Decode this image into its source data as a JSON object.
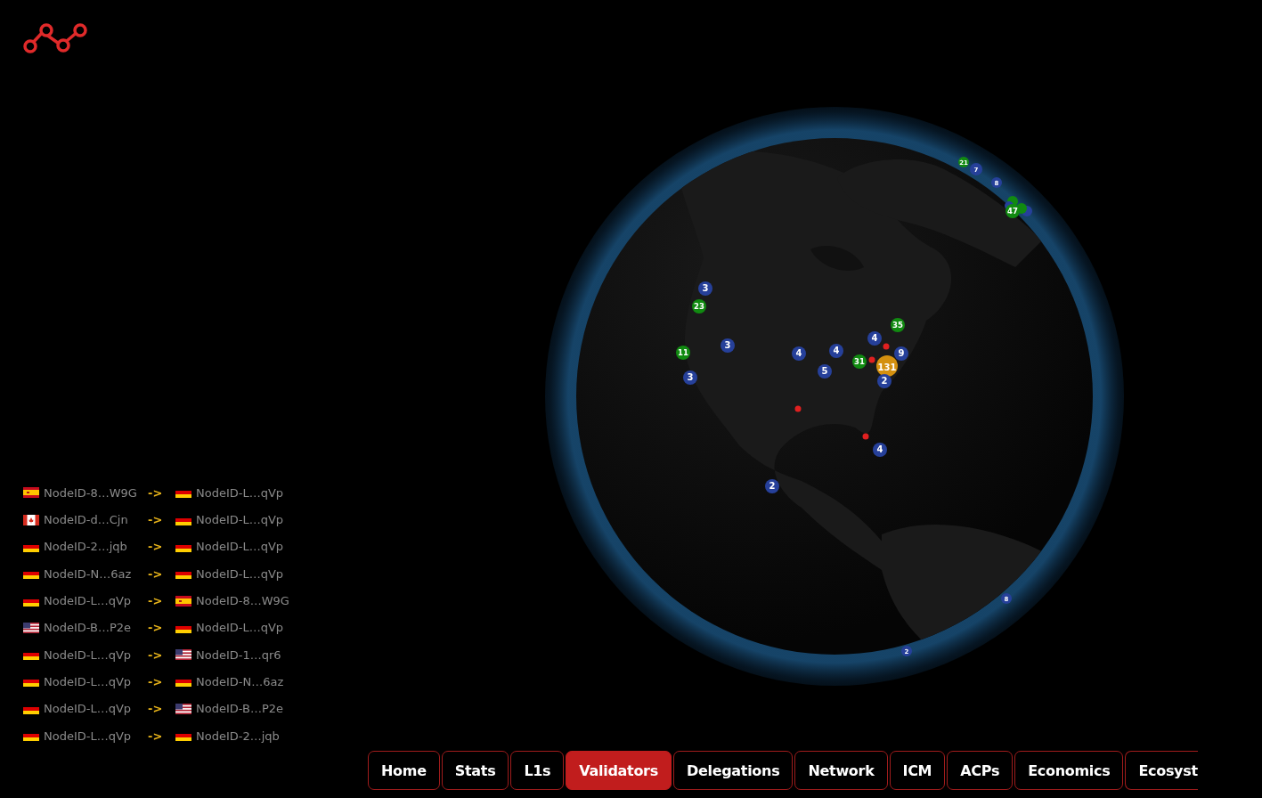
{
  "connections": [
    {
      "from": {
        "kind": "es",
        "node": "NodeID-8…W9G"
      },
      "arrow": "->",
      "to": {
        "kind": "de",
        "node": "NodeID-L…qVp"
      }
    },
    {
      "from": {
        "kind": "ca",
        "node": "NodeID-d…Cjn"
      },
      "arrow": "->",
      "to": {
        "kind": "de",
        "node": "NodeID-L…qVp"
      }
    },
    {
      "from": {
        "kind": "de",
        "node": "NodeID-2…jqb"
      },
      "arrow": "->",
      "to": {
        "kind": "de",
        "node": "NodeID-L…qVp"
      }
    },
    {
      "from": {
        "kind": "de",
        "node": "NodeID-N…6az"
      },
      "arrow": "->",
      "to": {
        "kind": "de",
        "node": "NodeID-L…qVp"
      }
    },
    {
      "from": {
        "kind": "de",
        "node": "NodeID-L…qVp"
      },
      "arrow": "->",
      "to": {
        "kind": "es",
        "node": "NodeID-8…W9G"
      }
    },
    {
      "from": {
        "kind": "us",
        "node": "NodeID-B…P2e"
      },
      "arrow": "->",
      "to": {
        "kind": "de",
        "node": "NodeID-L…qVp"
      }
    },
    {
      "from": {
        "kind": "de",
        "node": "NodeID-L…qVp"
      },
      "arrow": "->",
      "to": {
        "kind": "us",
        "node": "NodeID-1…qr6"
      }
    },
    {
      "from": {
        "kind": "de",
        "node": "NodeID-L…qVp"
      },
      "arrow": "->",
      "to": {
        "kind": "de",
        "node": "NodeID-N…6az"
      }
    },
    {
      "from": {
        "kind": "de",
        "node": "NodeID-L…qVp"
      },
      "arrow": "->",
      "to": {
        "kind": "us",
        "node": "NodeID-B…P2e"
      }
    },
    {
      "from": {
        "kind": "de",
        "node": "NodeID-L…qVp"
      },
      "arrow": "->",
      "to": {
        "kind": "de",
        "node": "NodeID-2…jqb"
      }
    }
  ],
  "markers": [
    {
      "label": "21",
      "color": "#118a11"
    },
    {
      "label": "7",
      "color": "#26409a"
    },
    {
      "label": "8",
      "color": "#26409a"
    },
    {
      "label": "47",
      "color": "#118a11"
    },
    {
      "label": "3",
      "color": "#26409a"
    },
    {
      "label": "23",
      "color": "#118a11"
    },
    {
      "label": "35",
      "color": "#118a11"
    },
    {
      "label": "3",
      "color": "#26409a"
    },
    {
      "label": "4",
      "color": "#26409a"
    },
    {
      "label": "11",
      "color": "#118a11"
    },
    {
      "label": "4",
      "color": "#26409a"
    },
    {
      "label": "4",
      "color": "#26409a"
    },
    {
      "label": "9",
      "color": "#26409a"
    },
    {
      "label": "31",
      "color": "#118a11"
    },
    {
      "label": "131",
      "color": "#d4900f"
    },
    {
      "label": "5",
      "color": "#26409a"
    },
    {
      "label": "3",
      "color": "#26409a"
    },
    {
      "label": "2",
      "color": "#26409a"
    },
    {
      "label": "4",
      "color": "#26409a"
    },
    {
      "label": "2",
      "color": "#26409a"
    },
    {
      "label": "8",
      "color": "#26409a"
    },
    {
      "label": "2",
      "color": "#26409a"
    }
  ],
  "tabs": [
    {
      "label": "Home",
      "selected": false
    },
    {
      "label": "Stats",
      "selected": false
    },
    {
      "label": "L1s",
      "selected": false
    },
    {
      "label": "Validators",
      "selected": true
    },
    {
      "label": "Delegations",
      "selected": false
    },
    {
      "label": "Network",
      "selected": false
    },
    {
      "label": "ICM",
      "selected": false
    },
    {
      "label": "ACPs",
      "selected": false
    },
    {
      "label": "Economics",
      "selected": false
    },
    {
      "label": "Ecosyst",
      "selected": false
    }
  ]
}
